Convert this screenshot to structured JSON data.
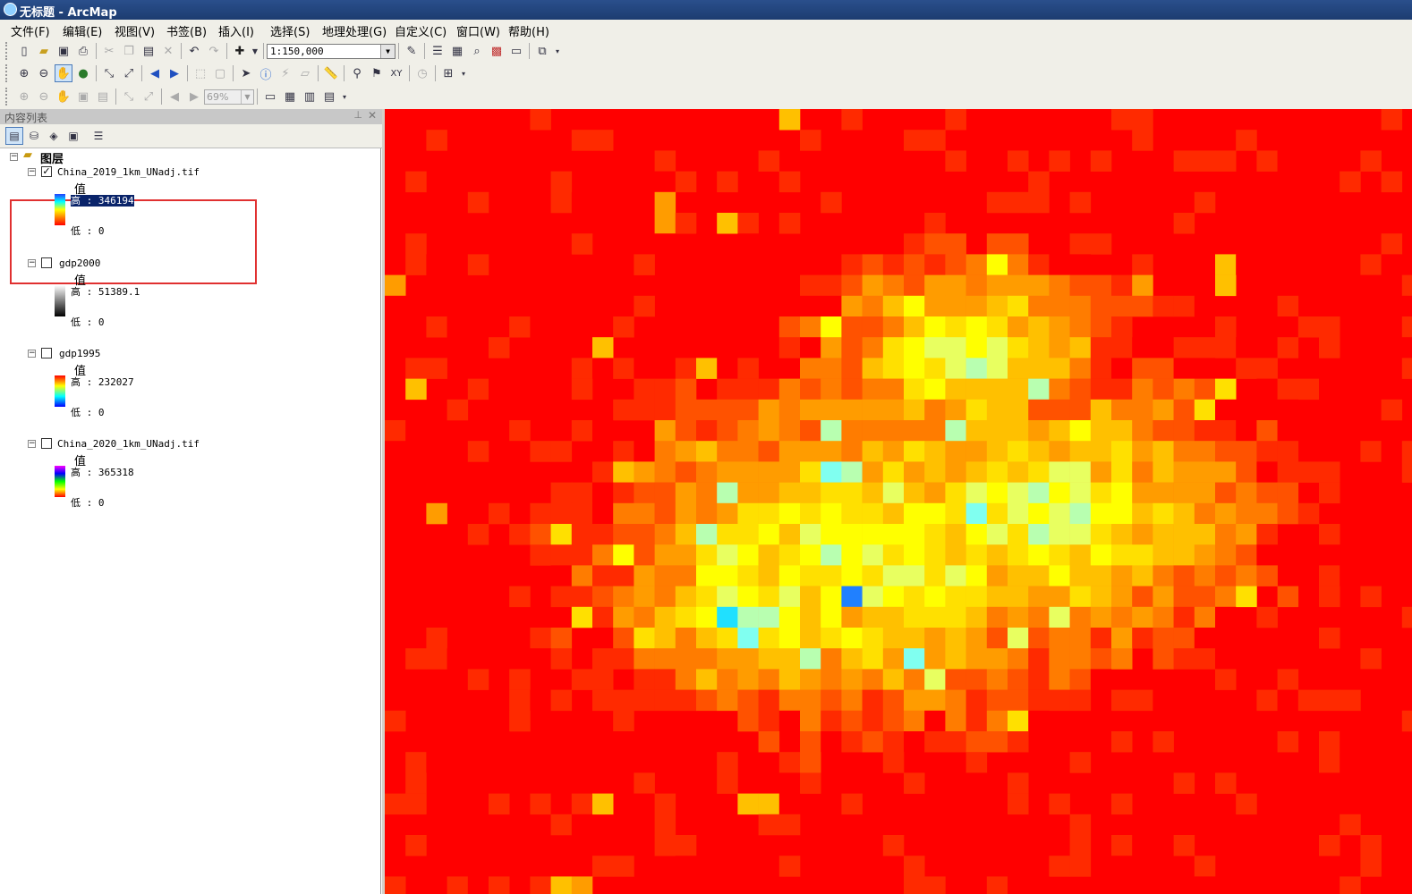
{
  "window": {
    "title": "无标题 - ArcMap"
  },
  "menu": [
    "文件(F)",
    "编辑(E)",
    "视图(V)",
    "书签(B)",
    "插入(I)",
    "选择(S)",
    "地理处理(G)",
    "自定义(C)",
    "窗口(W)",
    "帮助(H)"
  ],
  "toolbar": {
    "scale": "1:150,000",
    "layout_zoom": "69%"
  },
  "toc": {
    "title": "内容列表",
    "root": "图层",
    "value_label": "值",
    "high_label": "高",
    "low_label": "低",
    "layers": [
      {
        "name": "China_2019_1km_UNadj.tif",
        "checked": true,
        "high": "346194",
        "low": "0",
        "ramp": [
          "#2040ff",
          "#00ffff",
          "#ffff00",
          "#ff8000",
          "#ff0000"
        ]
      },
      {
        "name": "gdp2000",
        "checked": false,
        "high": "51389.1",
        "low": "0",
        "ramp": [
          "#ffffff",
          "#000000"
        ]
      },
      {
        "name": "gdp1995",
        "checked": false,
        "high": "232027",
        "low": "0",
        "ramp": [
          "#ff0000",
          "#ffff00",
          "#00ffff",
          "#0000ff"
        ]
      },
      {
        "name": "China_2020_1km_UNadj.tif",
        "checked": false,
        "high": "365318",
        "low": "0",
        "ramp": [
          "#ff00ff",
          "#0000ff",
          "#00ff00",
          "#ffff00",
          "#ff0000"
        ]
      }
    ]
  },
  "colors": {
    "accent": "#e03030",
    "highlight": "#0a246a",
    "map_background": "#ff0000"
  },
  "icons": [
    "new-file-icon",
    "open-icon",
    "save-icon",
    "print-icon",
    "cut-icon",
    "copy-icon",
    "paste-icon",
    "delete-icon",
    "undo-icon",
    "redo-icon",
    "add-data-icon",
    "zoom-in-icon",
    "zoom-out-icon",
    "pan-icon",
    "full-extent-icon",
    "identify-icon",
    "find-icon",
    "go-to-xy-icon"
  ]
}
